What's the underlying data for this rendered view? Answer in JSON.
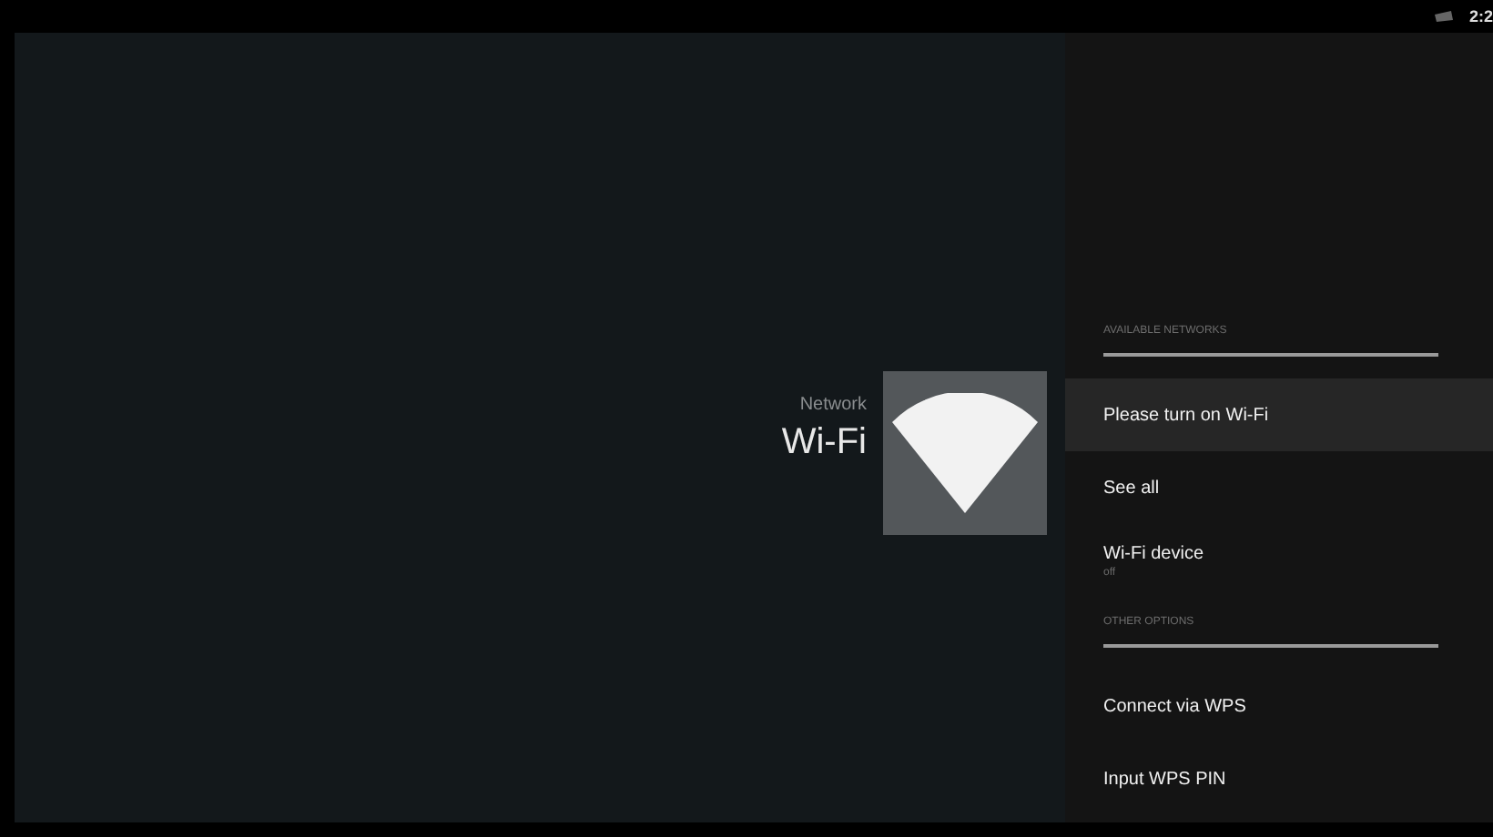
{
  "status_bar": {
    "clock": "2:2"
  },
  "heading": {
    "category": "Network",
    "title": "Wi-Fi"
  },
  "sections": [
    {
      "header": "AVAILABLE NETWORKS",
      "items": [
        {
          "label": "Please turn on Wi-Fi",
          "selected": true
        },
        {
          "label": "See all",
          "selected": false
        },
        {
          "label": "Wi-Fi device",
          "subtitle": "off",
          "selected": false
        }
      ]
    },
    {
      "header": "OTHER OPTIONS",
      "items": [
        {
          "label": "Connect via WPS",
          "selected": false
        },
        {
          "label": "Input WPS PIN",
          "selected": false
        }
      ]
    }
  ]
}
